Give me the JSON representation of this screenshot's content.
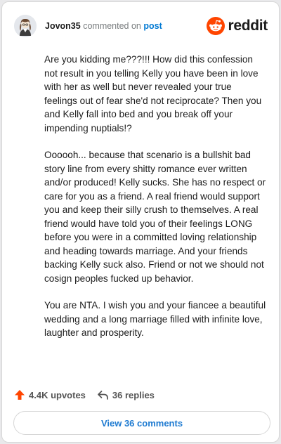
{
  "header": {
    "username": "Jovon35",
    "action_text": "commented on",
    "post_link": "post",
    "brand": "reddit",
    "brand_color": "#ff4500",
    "avatar_icon": "user-avatar-icon"
  },
  "comment": {
    "paragraphs": [
      "Are you kidding me???!!! How did this confession not result in you telling Kelly you have been in love with her as well but never revealed your true feelings out of fear she'd not reciprocate? Then you and Kelly fall into bed and you break off your impending nuptials!?",
      "Oooooh... because that scenario is a bullshit bad story line from every shitty romance ever written and/or produced! Kelly sucks. She has no respect or care for you as a friend. A real friend would support you and keep their silly crush to themselves. A real friend would have told you of their feelings LONG before you were in a committed loving relationship and heading towards marriage. And your friends backing Kelly suck also. Friend or not we should not cosign peoples fucked up behavior.",
      "You are NTA. I wish you and your fiancee a beautiful wedding and a long marriage filled with infinite love, laughter and prosperity."
    ]
  },
  "actions": {
    "upvotes": "4.4K upvotes",
    "replies": "36 replies",
    "upvote_color": "#ff4500"
  },
  "footer": {
    "view_comments": "View 36 comments",
    "link_color": "#1f7bd1"
  }
}
